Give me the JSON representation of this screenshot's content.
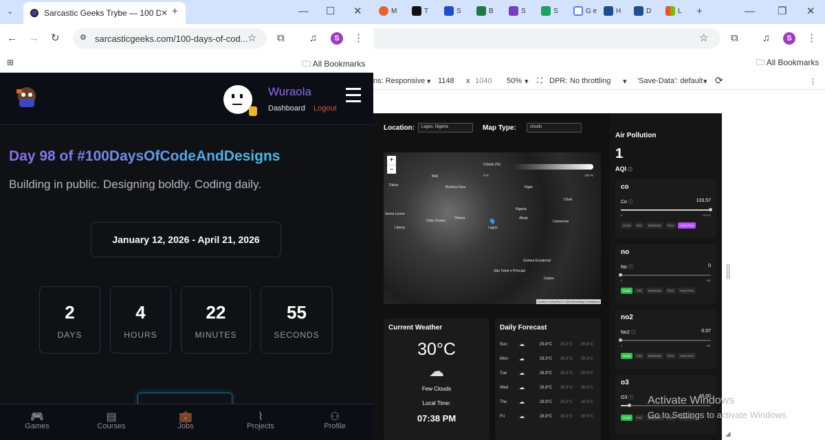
{
  "left_window": {
    "tab_title": "Sarcastic Geeks Trybe — 100 Da",
    "url": "sarcasticgeeks.com/100-days-of-cod...",
    "all_bookmarks": "All Bookmarks",
    "profile_initial": "S",
    "site": {
      "username": "Wuraola",
      "dashboard": "Dashboard",
      "logout": "Logout",
      "title": "Day 98 of #100DaysOfCodeAndDesigns",
      "subtitle": "Building in public. Designing boldly. Coding daily.",
      "date_range": "January 12, 2026 - April 21, 2026",
      "countdown": [
        {
          "value": "2",
          "label": "DAYS"
        },
        {
          "value": "4",
          "label": "HOURS"
        },
        {
          "value": "22",
          "label": "MINUTES"
        },
        {
          "value": "55",
          "label": "SECONDS"
        }
      ],
      "nav": [
        {
          "label": "Games",
          "icon": "gamepad-icon"
        },
        {
          "label": "Courses",
          "icon": "book-icon"
        },
        {
          "label": "Jobs",
          "icon": "briefcase-icon"
        },
        {
          "label": "Projects",
          "icon": "rss-icon"
        },
        {
          "label": "Profile",
          "icon": "user-icon"
        }
      ]
    }
  },
  "right_window": {
    "tabs": [
      "M",
      "T",
      "S",
      "B",
      "S",
      "S",
      "G e",
      "H",
      "D",
      "L"
    ],
    "all_bookmarks": "All Bookmarks",
    "profile_initial": "S",
    "devtools": {
      "dimensions_label": "ns: Responsive",
      "width": "1148",
      "x": "x",
      "height": "1040",
      "zoom": "50%",
      "dpr": "DPR:",
      "throttling": "No throttling",
      "save_data": "'Save-Data': default"
    },
    "weather_app": {
      "location_label": "Location:",
      "location_value": "Lagos, Nigeria",
      "map_type_label": "Map Type:",
      "map_type_value": "clouds",
      "map_legend_title": "Clouds (%)",
      "map_legend_min": "0 %",
      "map_legend_max": "100 %",
      "map_attribution": "Leaflet | © MapTiler © OpenStreetMap contributors",
      "map_cities": [
        {
          "name": "Dakar"
        },
        {
          "name": "Mali"
        },
        {
          "name": "Burkina Faso"
        },
        {
          "name": "Côte d'Ivoire"
        },
        {
          "name": "Ghana"
        },
        {
          "name": "Nigeria"
        },
        {
          "name": "Lagos"
        },
        {
          "name": "Abuja"
        },
        {
          "name": "Cameroon"
        },
        {
          "name": "Niger"
        },
        {
          "name": "Chad"
        },
        {
          "name": "Gabon"
        },
        {
          "name": "Sierra Leone"
        },
        {
          "name": "Liberia"
        },
        {
          "name": "Guinea Ecuatorial"
        },
        {
          "name": "São Tomé e Príncipe"
        }
      ],
      "current_weather": {
        "title": "Current Weather",
        "temp": "30°C",
        "condition": "Few Clouds",
        "local_time_label": "Local Time:",
        "local_time_value": "07:38 PM"
      },
      "daily_forecast": {
        "title": "Daily Forecast",
        "rows": [
          {
            "day": "Sun",
            "t1": "29.8°C",
            "t2": "29.2°C",
            "t3": "29.8°C"
          },
          {
            "day": "Mon",
            "t1": "29.3°C",
            "t2": "28.9°C",
            "t3": "29.3°C"
          },
          {
            "day": "Tue",
            "t1": "28.9°C",
            "t2": "28.9°C",
            "t3": "28.9°C"
          },
          {
            "day": "Wed",
            "t1": "28.8°C",
            "t2": "28.8°C",
            "t3": "28.8°C"
          },
          {
            "day": "Thu",
            "t1": "28.9°C",
            "t2": "28.9°C",
            "t3": "28.9°C"
          },
          {
            "day": "Fri",
            "t1": "28.9°C",
            "t2": "28.9°C",
            "t3": "28.9°C"
          }
        ]
      },
      "air_pollution": {
        "title": "Air Pollution",
        "aqi_value": "1",
        "aqi_label": "AQI",
        "levels": [
          "Good",
          "Fair",
          "Moderate",
          "Poor",
          "Very Poor"
        ],
        "cards": [
          {
            "name": "co",
            "label": "Co",
            "value": "103.57",
            "min": "0",
            "max": "103.57",
            "fill": 1.0,
            "active": 4
          },
          {
            "name": "no",
            "label": "No",
            "value": "0",
            "min": "0",
            "max": "281",
            "fill": 0.0,
            "active": 0
          },
          {
            "name": "no2",
            "label": "No2",
            "value": "0.07",
            "min": "0",
            "max": "281",
            "fill": 0.0,
            "active": 0
          },
          {
            "name": "o3",
            "label": "O3",
            "value": "15.00",
            "min": "",
            "max": "",
            "fill": 0.1,
            "active": 0
          }
        ]
      }
    }
  },
  "watermark": {
    "line1": "Activate Windows",
    "line2": "Go to Settings to activate Windows."
  },
  "colors": {
    "tabstrip": "#d3e3fd",
    "accent_purple": "#8c6cf0",
    "accent_cyan": "#3fc3e6",
    "good_green": "#2fbf4f",
    "very_poor_purple": "#b34dff",
    "logout_red": "#e0523b"
  }
}
